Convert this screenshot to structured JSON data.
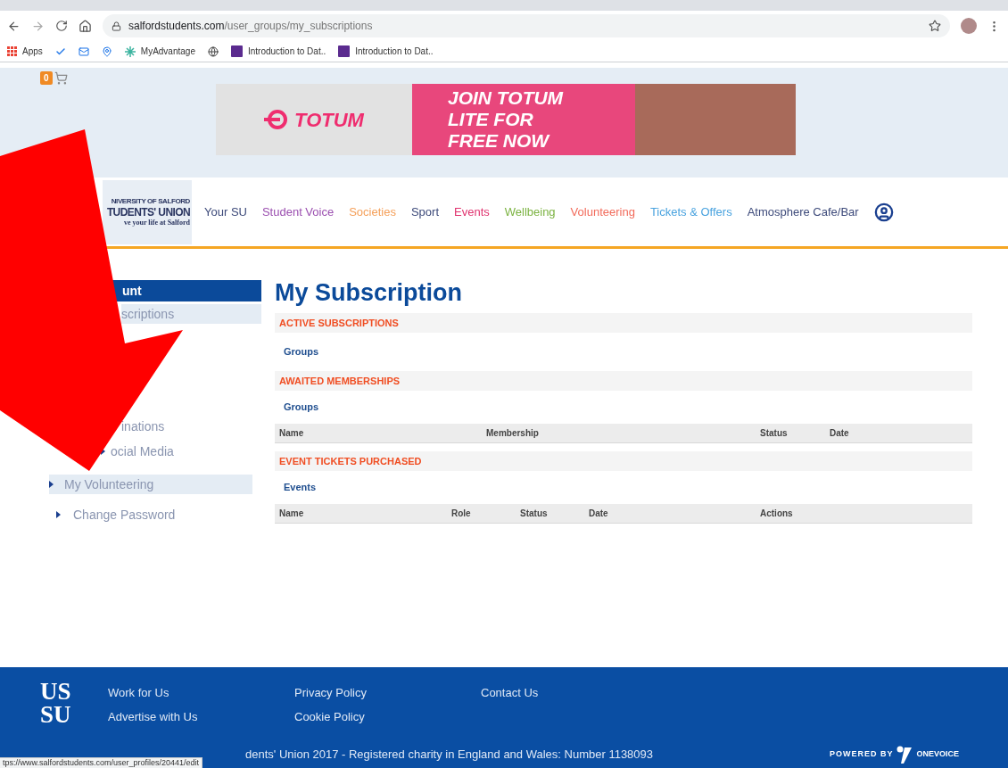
{
  "browser": {
    "url_host": "salfordstudents.com",
    "url_path": "/user_groups/my_subscriptions",
    "bookmarks": [
      {
        "label": "Apps",
        "kind": "apps"
      },
      {
        "kind": "check"
      },
      {
        "kind": "mail"
      },
      {
        "kind": "pin"
      },
      {
        "label": "MyAdvantage",
        "kind": "star"
      },
      {
        "kind": "globe"
      },
      {
        "label": "Introduction to Dat..",
        "kind": "m"
      },
      {
        "label": "Introduction to Dat..",
        "kind": "m"
      }
    ]
  },
  "header": {
    "cart_count": "0",
    "banner": {
      "brand": "TOTUM",
      "headline": [
        "JOIN TOTUM",
        "LITE FOR",
        "FREE NOW"
      ]
    }
  },
  "logo": [
    "NIVERSITY OF SALFORD",
    "TUDENTS' UNION",
    "ve your life at Salford"
  ],
  "nav": [
    {
      "label": "Your SU",
      "color": "#3d4a7a"
    },
    {
      "label": "Student Voice",
      "color": "#9b4fb0"
    },
    {
      "label": "Societies",
      "color": "#f5a05a"
    },
    {
      "label": "Sport",
      "color": "#3d4a7a"
    },
    {
      "label": "Events",
      "color": "#e0336f"
    },
    {
      "label": "Wellbeing",
      "color": "#7cb342"
    },
    {
      "label": "Volunteering",
      "color": "#f26b5b"
    },
    {
      "label": "Tickets & Offers",
      "color": "#4aa3df"
    },
    {
      "label": "Atmosphere Cafe/Bar",
      "color": "#3d4a7a"
    }
  ],
  "sidebar": {
    "header": "unt",
    "items": [
      {
        "label": "scriptions",
        "selected": true,
        "bullet": false
      },
      {
        "label": "inations",
        "selected": false,
        "bullet": false
      },
      {
        "label": "ocial Media",
        "selected": false,
        "bullet": true
      },
      {
        "label": "My Volunteering",
        "selected": true,
        "bullet": true
      },
      {
        "label": "Change Password",
        "selected": false,
        "bullet": true
      }
    ]
  },
  "content": {
    "title": "My Subscription",
    "sections": [
      {
        "title": "ACTIVE SUBSCRIPTIONS",
        "subheading": "Groups"
      },
      {
        "title": "AWAITED MEMBERSHIPS",
        "subheading": "Groups",
        "columns": [
          "Name",
          "Membership",
          "Status",
          "Date"
        ]
      },
      {
        "title": "EVENT TICKETS PURCHASED",
        "subheading": "Events",
        "columns": [
          "Name",
          "Role",
          "Status",
          "Date",
          "Actions"
        ]
      }
    ]
  },
  "footer": {
    "logo": [
      "US",
      "SU"
    ],
    "link_columns": [
      [
        "Work for Us",
        "Advertise with Us"
      ],
      [
        "Privacy Policy",
        "Cookie Policy"
      ],
      [
        "Contact Us"
      ]
    ],
    "copyright": "dents' Union 2017 - Registered charity in England and Wales: Number 1138093",
    "powered_by": "POWERED BY",
    "powered_brand": "ONEVOICE"
  },
  "status_url": "tps://www.salfordstudents.com/user_profiles/20441/edit"
}
